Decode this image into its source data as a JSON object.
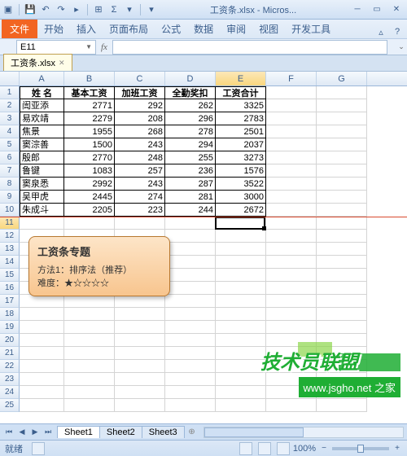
{
  "window": {
    "title": "工资条.xlsx - Micros..."
  },
  "ribbon": {
    "file": "文件",
    "tabs": [
      "开始",
      "插入",
      "页面布局",
      "公式",
      "数据",
      "审阅",
      "视图",
      "开发工具"
    ]
  },
  "formula_bar": {
    "name_box": "E11",
    "fx": "fx",
    "value": ""
  },
  "workbook_tab": {
    "name": "工资条.xlsx"
  },
  "columns": [
    "A",
    "B",
    "C",
    "D",
    "E",
    "F",
    "G"
  ],
  "table": {
    "headers": [
      "姓 名",
      "基本工资",
      "加班工资",
      "全勤奖扣",
      "工资合计"
    ],
    "rows": [
      [
        "訚亚添",
        "2771",
        "292",
        "262",
        "3325"
      ],
      [
        "易欢靖",
        "2279",
        "208",
        "296",
        "2783"
      ],
      [
        "焦景",
        "1955",
        "268",
        "278",
        "2501"
      ],
      [
        "窦淙善",
        "1500",
        "243",
        "294",
        "2037"
      ],
      [
        "殷郎",
        "2770",
        "248",
        "255",
        "3273"
      ],
      [
        "鲁键",
        "1083",
        "257",
        "236",
        "1576"
      ],
      [
        "窦泉悉",
        "2992",
        "243",
        "287",
        "3522"
      ],
      [
        "吴甲虎",
        "2445",
        "274",
        "281",
        "3000"
      ],
      [
        "朱成斗",
        "2205",
        "223",
        "244",
        "2672"
      ]
    ]
  },
  "callout": {
    "title": "工资条专题",
    "line1_label": "方法1：",
    "line1_value": "排序法（推荐）",
    "line2_label": "难度：",
    "stars_filled": "★",
    "stars_empty": "☆☆☆☆"
  },
  "watermark": {
    "brand": "技术员联盟",
    "url": "www.jsgho.net",
    "suffix": "之家"
  },
  "sheets": {
    "tabs": [
      "Sheet1",
      "Sheet2",
      "Sheet3"
    ]
  },
  "statusbar": {
    "mode": "就绪",
    "zoom": "100%"
  },
  "active_cell": "E11",
  "empty_rows_start": 11,
  "empty_rows_end": 25
}
